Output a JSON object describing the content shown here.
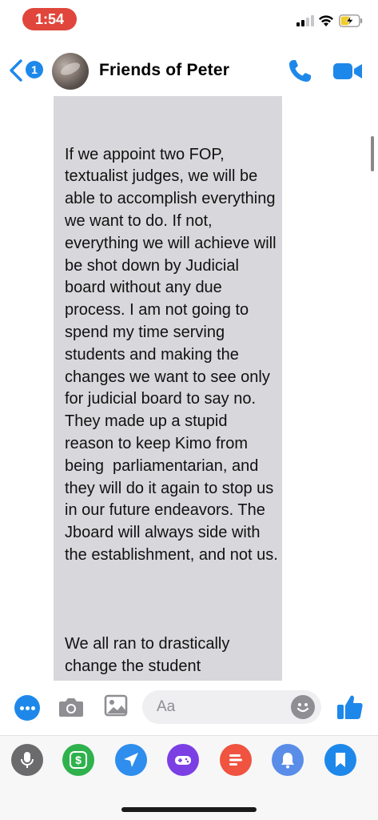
{
  "status_bar": {
    "time": "1:54"
  },
  "header": {
    "title": "Friends of Peter",
    "back_badge": "1"
  },
  "message": {
    "paragraphs": [
      "If we appoint two FOP, textualist judges, we will be able to accomplish everything we want to do. If not, everything we will achieve will be shot down by Judicial board without any due process. I am not going to spend my time serving students and making the changes we want to see only for judicial board to say no. They made up a stupid reason to keep Kimo from being  parliamentarian, and they will do it again to stop us in our future endeavors. The Jboard will always side with the establishment, and not us.",
      "We all ran to drastically change the student government, and the only way we can achieve this is by appointing judges that share"
    ]
  },
  "composer": {
    "placeholder": "Aa"
  },
  "apps": [
    {
      "name": "voice-memo",
      "color": "#6b6b6e"
    },
    {
      "name": "money",
      "color": "#2fb24c"
    },
    {
      "name": "location",
      "color": "#2e8ded"
    },
    {
      "name": "games",
      "color": "#7b3fe4"
    },
    {
      "name": "polls",
      "color": "#f0533f"
    },
    {
      "name": "reminders",
      "color": "#5a8de8"
    },
    {
      "name": "bookmark",
      "color": "#1e88ea"
    }
  ],
  "colors": {
    "accent": "#1e88ea",
    "time_pill": "#e0463b",
    "bubble": "#d8d8dc"
  }
}
